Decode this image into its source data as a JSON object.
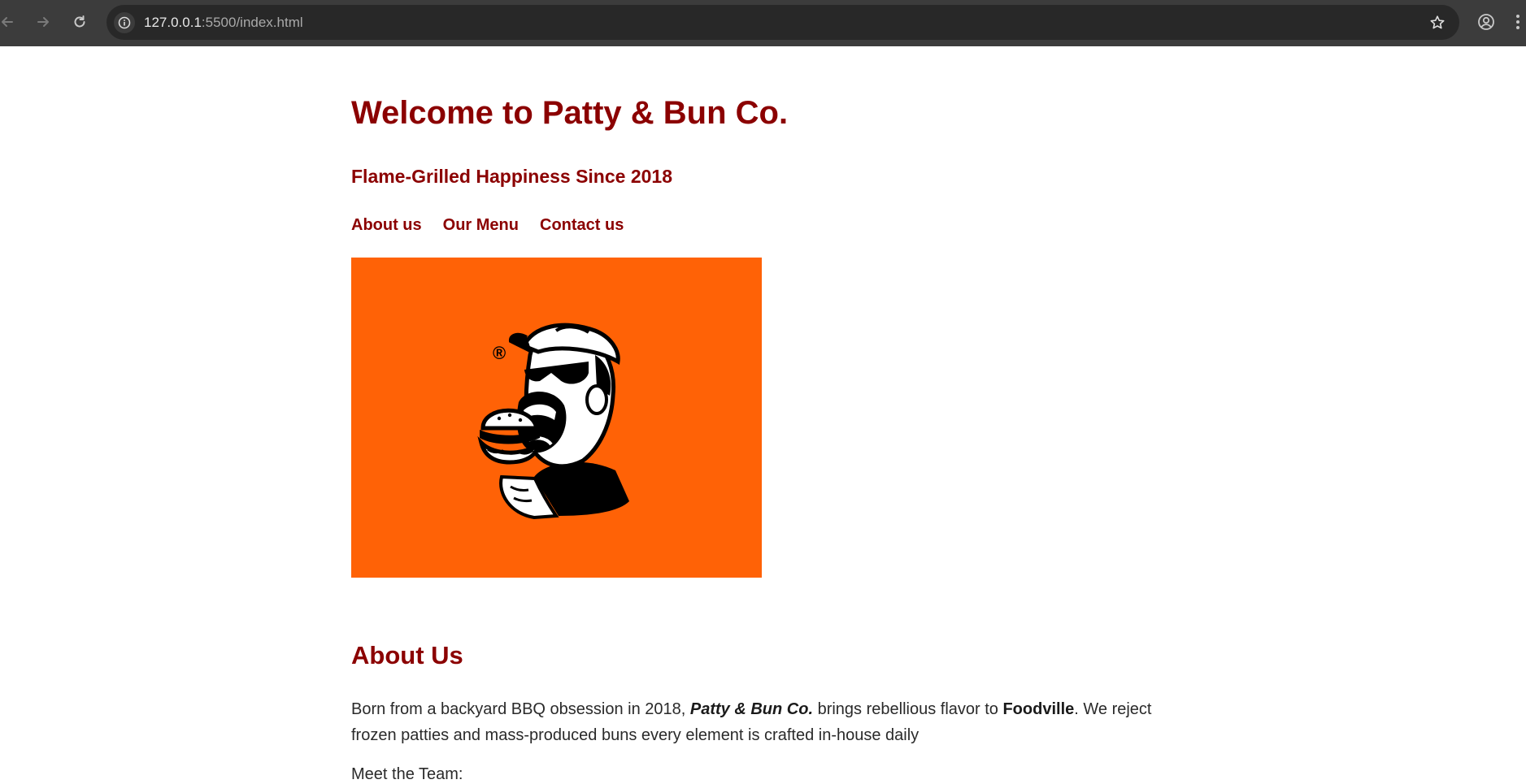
{
  "browser": {
    "url_host": "127.0.0.1",
    "url_port_path": ":5500/index.html",
    "back_icon": "arrow-left-icon",
    "forward_icon": "arrow-right-icon",
    "reload_icon": "reload-icon",
    "site_info_icon": "info-icon",
    "bookmark_icon": "star-icon",
    "profile_icon": "profile-icon",
    "menu_icon": "kebab-menu-icon"
  },
  "header": {
    "title": "Welcome to Patty & Bun Co.",
    "tagline": "Flame-Grilled Happiness Since 2018"
  },
  "nav": {
    "items": [
      {
        "label": "About us"
      },
      {
        "label": "Our Menu"
      },
      {
        "label": "Contact us"
      }
    ]
  },
  "hero": {
    "registered_mark": "®",
    "background_color": "#ff6206"
  },
  "about": {
    "heading": "About Us",
    "text_before": "Born from a backyard BBQ obsession in 2018, ",
    "brand_name": "Patty & Bun Co.",
    "text_middle": " brings rebellious flavor to ",
    "city": "Foodville",
    "text_after": ". We reject frozen patties and mass-produced buns every element is crafted in-house daily",
    "team_label": "Meet the Team:"
  },
  "colors": {
    "heading": "#8b0000",
    "body_text": "#2a2a2a",
    "chrome": "#3c3c3c"
  }
}
